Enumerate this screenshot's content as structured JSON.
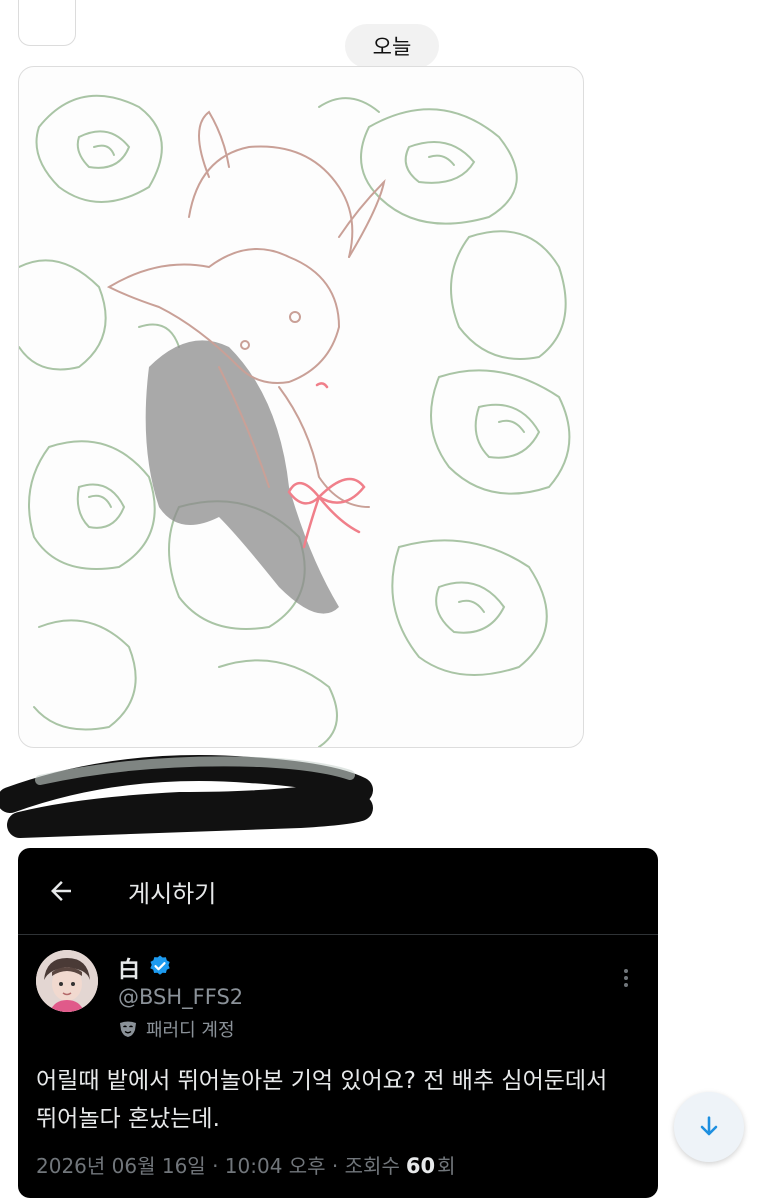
{
  "chat": {
    "date_separator": "오늘"
  },
  "tweet": {
    "header_title": "게시하기",
    "display_name": "白",
    "handle": "@BSH_FFS2",
    "account_label": "패러디 계정",
    "text": "어릴때 밭에서 뛰어놀아본 기억 있어요? 전 배추 심어둔데서\n뛰어놀다 혼났는데.",
    "timestamp": "2026년 06월 16일 · 10:04 오후 · 조회수",
    "views": "60",
    "views_suffix": "회"
  },
  "icons": {
    "back": "arrow-left-icon",
    "verified": "verified-badge-icon",
    "parody": "mask-icon",
    "more": "more-vertical-icon",
    "scroll": "arrow-down-icon"
  },
  "colors": {
    "verified_blue": "#1d9bf0",
    "rose_line": "#a9c4a5",
    "sketch_line": "#c9a097",
    "ribbon_pink": "#f07f8a",
    "scroll_arrow": "#1d8fe0"
  }
}
